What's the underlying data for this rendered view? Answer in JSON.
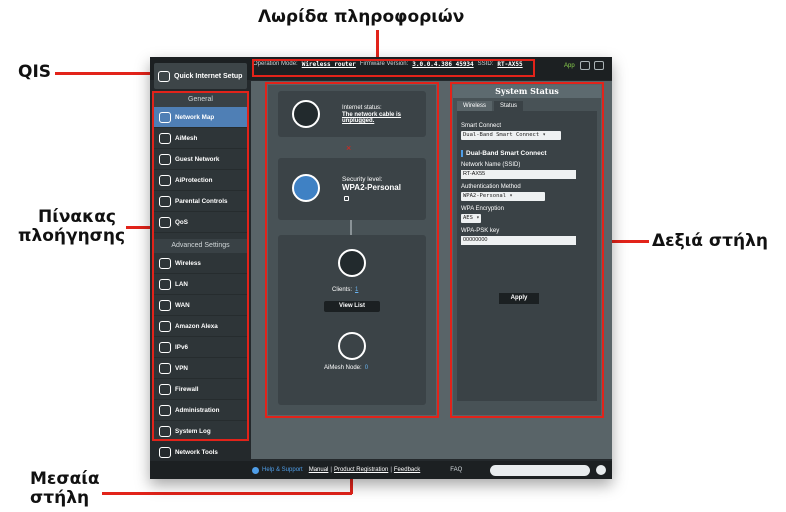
{
  "callouts": {
    "info_bar": "Λωρίδα πληροφοριών",
    "qis": "QIS",
    "nav_panel_line1": "Πίνακας",
    "nav_panel_line2": "πλοήγησης",
    "right_col": "Δεξιά στήλη",
    "mid_col_line1": "Μεσαία",
    "mid_col_line2": "στήλη"
  },
  "topbar": {
    "qis_label": "Quick Internet Setup",
    "op_mode_label": "Operation Mode:",
    "op_mode_value": "Wireless router",
    "fw_label": "Firmware Version:",
    "fw_value": "3.0.0.4.386_45934",
    "ssid_label": "SSID:",
    "ssid_value": "RT-AX55",
    "app_label": "App"
  },
  "sidebar": {
    "general_header": "General",
    "general_items": [
      {
        "label": "Network Map",
        "icon": "network-map-icon"
      },
      {
        "label": "AiMesh",
        "icon": "aimesh-icon"
      },
      {
        "label": "Guest Network",
        "icon": "guest-network-icon"
      },
      {
        "label": "AiProtection",
        "icon": "aiprotection-icon"
      },
      {
        "label": "Parental Controls",
        "icon": "parental-controls-icon"
      },
      {
        "label": "QoS",
        "icon": "qos-icon"
      }
    ],
    "advanced_header": "Advanced Settings",
    "advanced_items": [
      {
        "label": "Wireless",
        "icon": "wireless-icon"
      },
      {
        "label": "LAN",
        "icon": "lan-icon"
      },
      {
        "label": "WAN",
        "icon": "wan-icon"
      },
      {
        "label": "Amazon Alexa",
        "icon": "alexa-icon"
      },
      {
        "label": "IPv6",
        "icon": "ipv6-icon"
      },
      {
        "label": "VPN",
        "icon": "vpn-icon"
      },
      {
        "label": "Firewall",
        "icon": "firewall-icon"
      },
      {
        "label": "Administration",
        "icon": "administration-icon"
      },
      {
        "label": "System Log",
        "icon": "system-log-icon"
      },
      {
        "label": "Network Tools",
        "icon": "network-tools-icon"
      }
    ]
  },
  "middle": {
    "internet_status_label": "Internet status:",
    "internet_status_value": "The network cable is unplugged.",
    "disconnect_mark": "×",
    "security_label": "Security level:",
    "security_value": "WPA2-Personal",
    "clients_label": "Clients:",
    "clients_value": "1",
    "view_list": "View List",
    "aimesh_label": "AiMesh Node:",
    "aimesh_value": "0"
  },
  "right": {
    "title": "System Status",
    "tab_wireless": "Wireless",
    "tab_status": "Status",
    "smart_connect_label": "Smart Connect",
    "smart_connect_value": "Dual-Band Smart Connect ▾",
    "section_title": "Dual-Band Smart Connect",
    "ssid_label": "Network Name (SSID)",
    "ssid_value": "RT-AX55",
    "auth_label": "Authentication Method",
    "auth_value": "WPA2-Personal ▾",
    "enc_label": "WPA Encryption",
    "enc_value": "AES ▾",
    "psk_label": "WPA-PSK key",
    "psk_value": "00000000",
    "apply": "Apply"
  },
  "footer": {
    "help": "Help & Support",
    "manual": "Manual",
    "product_reg": "Product Registration",
    "feedback": "Feedback",
    "faq": "FAQ"
  },
  "colors": {
    "highlight": "#e2231a",
    "active_item": "#4f7fb5",
    "app_green": "#8bd24e"
  }
}
